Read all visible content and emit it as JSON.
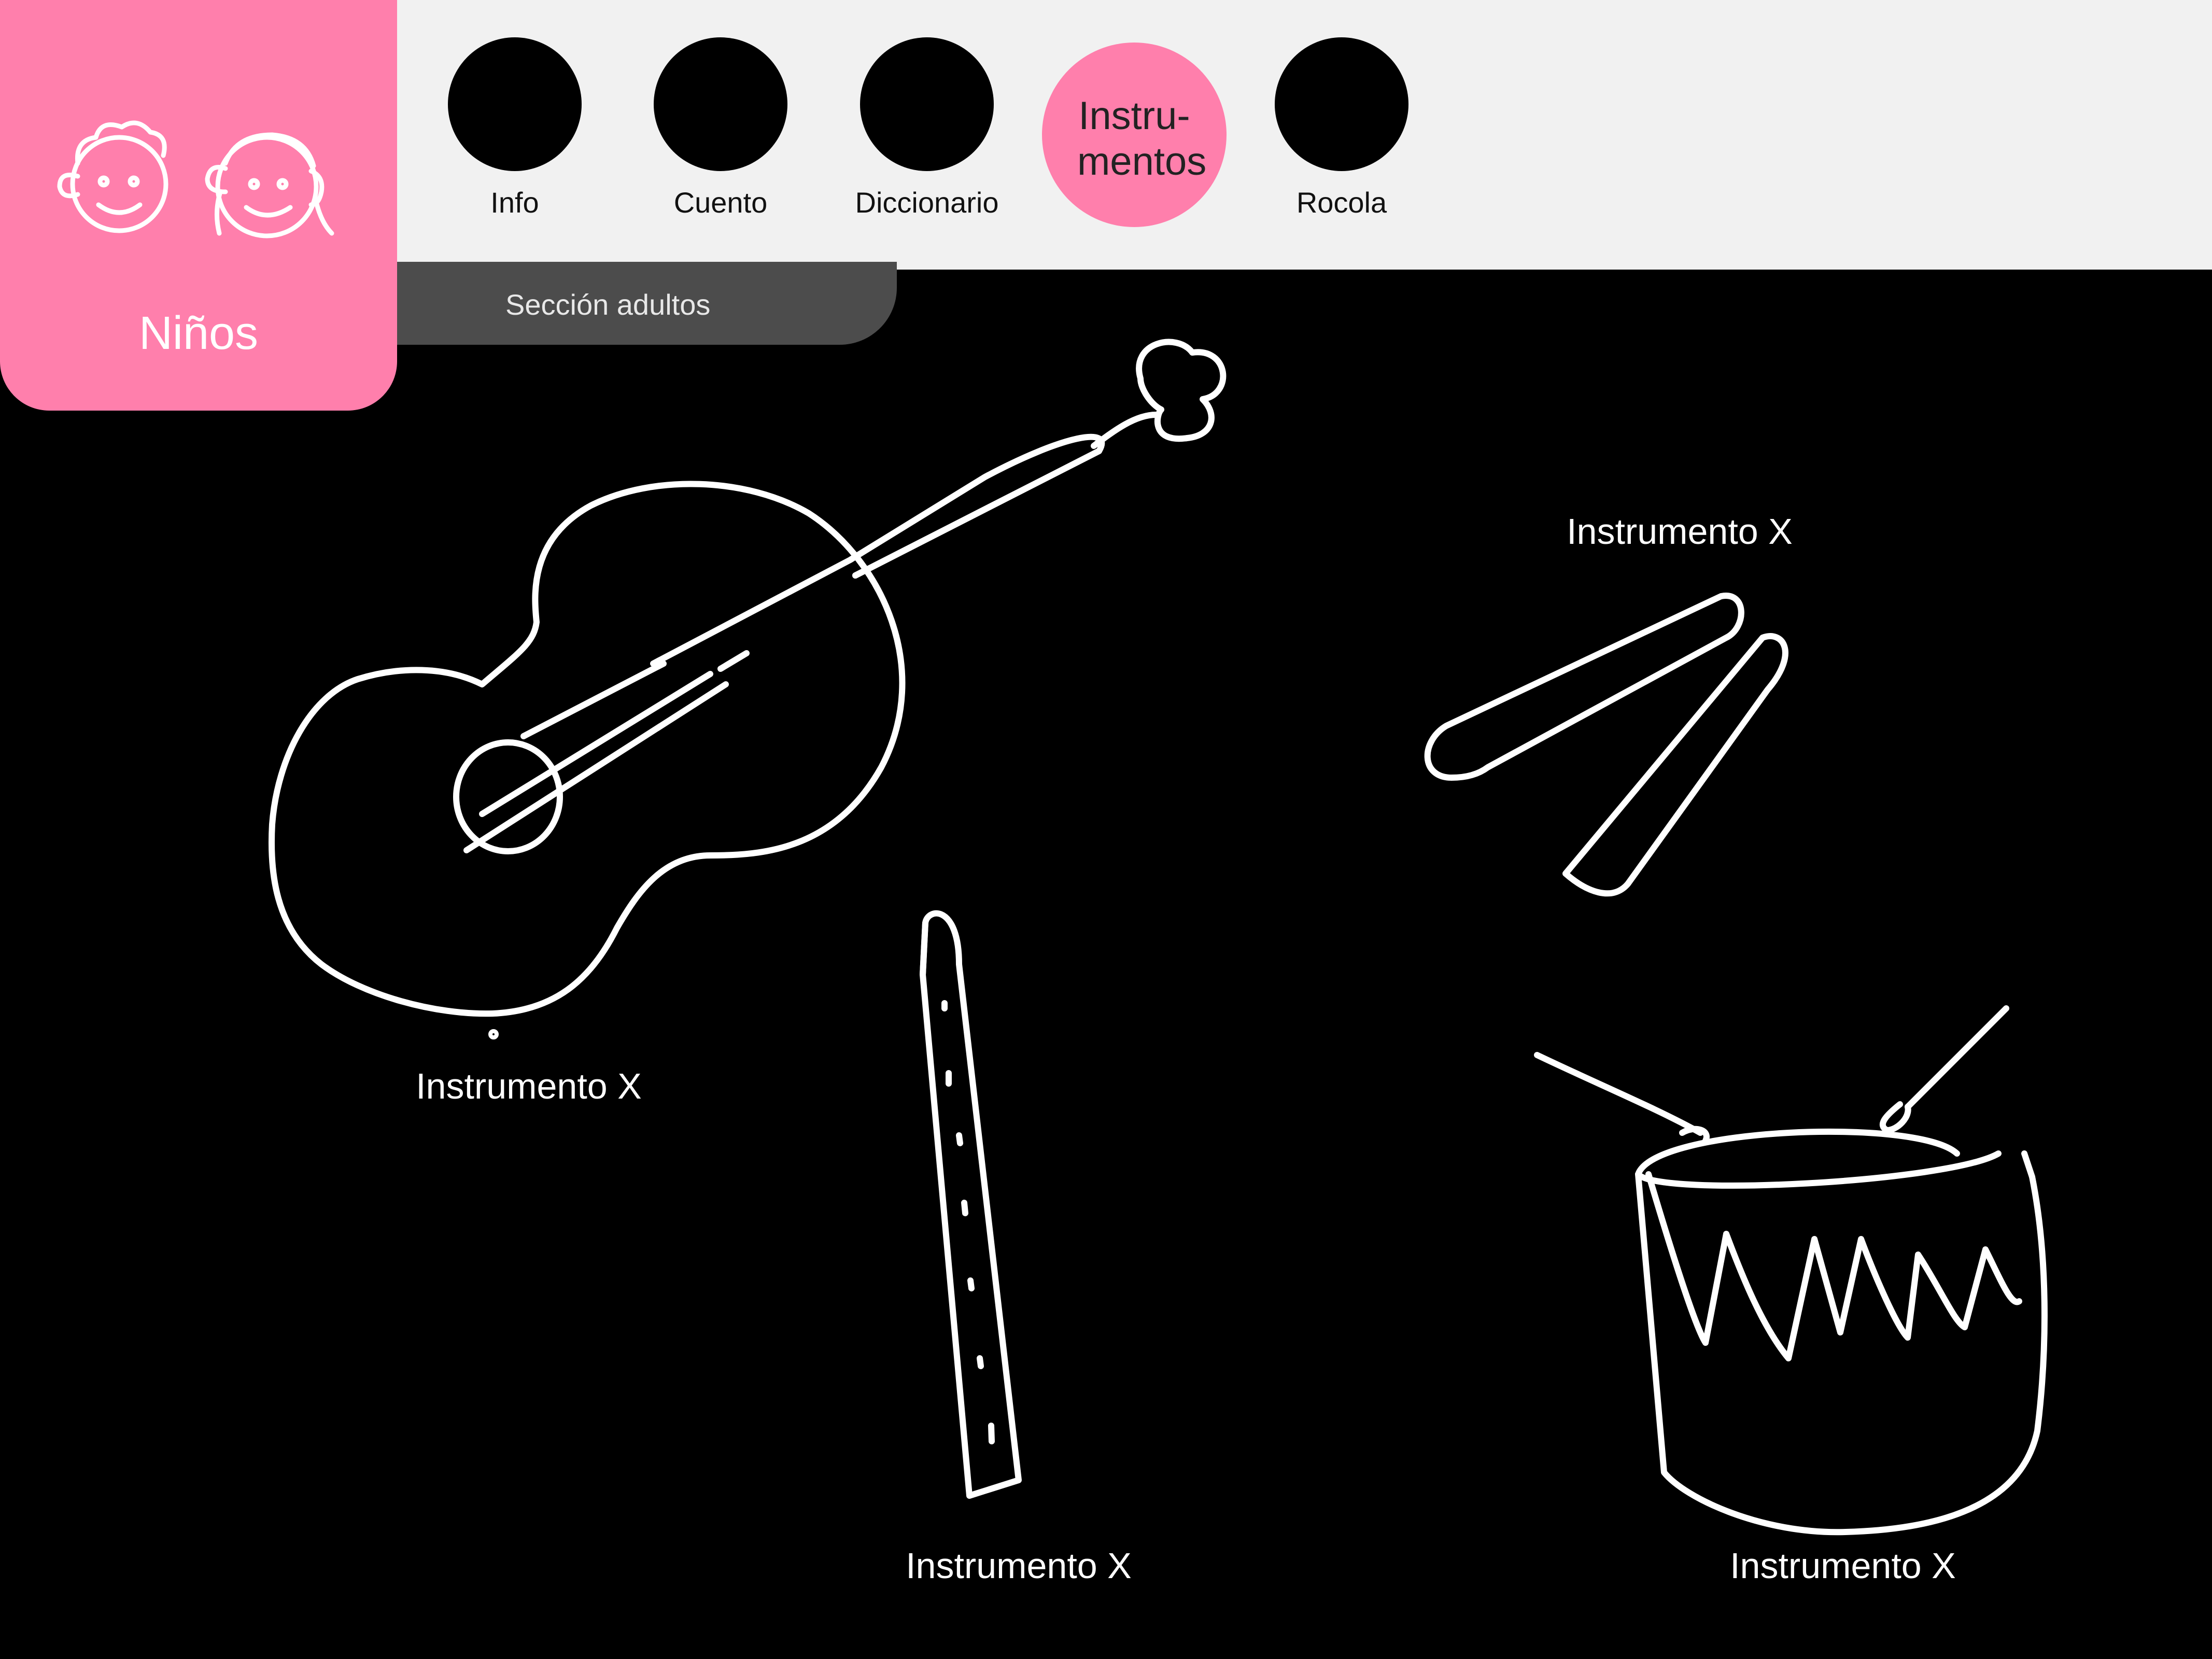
{
  "nav": {
    "items": [
      {
        "label": "Info"
      },
      {
        "label": "Cuento"
      },
      {
        "label": "Diccionario"
      },
      {
        "label": "Instru-\nmentos"
      },
      {
        "label": "Rocola"
      }
    ]
  },
  "tabs": {
    "kids_label": "Niños",
    "adults_label": "Sección adultos"
  },
  "instruments": [
    {
      "label": "Instrumento X"
    },
    {
      "label": "Instrumento X"
    },
    {
      "label": "Instrumento X"
    },
    {
      "label": "Instrumento X"
    }
  ],
  "colors": {
    "accent": "#ff7fac",
    "topbar": "#f1f1f1",
    "adults_tab": "#4c4c4c",
    "background": "#000000"
  }
}
